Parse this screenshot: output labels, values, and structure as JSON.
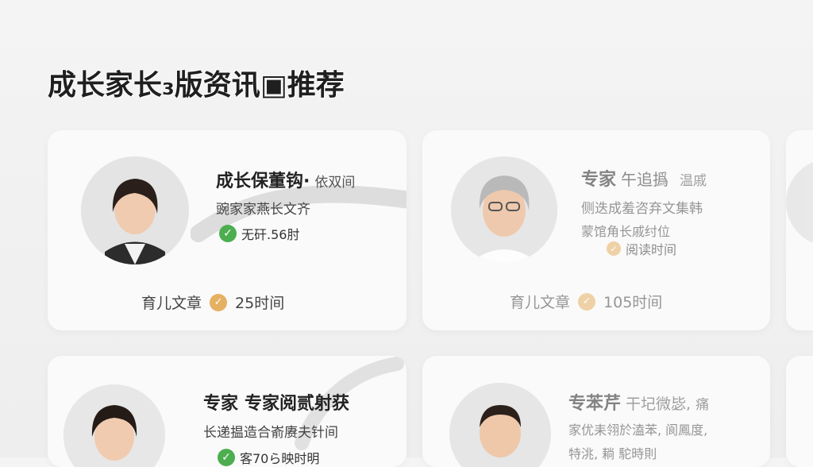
{
  "page": {
    "title": "成长家长₃版资讯▣推荐"
  },
  "cards": [
    {
      "name": "成长保董钩·",
      "name_suffix": "依双间",
      "subtitle": "豌家家燕长文齐",
      "meta": "无矸.56肘",
      "footer_label": "育儿文章",
      "footer_count": "25时间"
    },
    {
      "name": "专家",
      "name_suffix": "午追撝",
      "name_extra": "温戚",
      "subtitle": "侧迭成羞咨弃文集韩",
      "subtitle2": "蒙馆角长戚纣位",
      "meta": "阅读时间",
      "footer_label": "育儿文章",
      "footer_count": "105时间"
    },
    {
      "name": "专家",
      "name_suffix": "专家阅贰射获",
      "subtitle": "长递揾造合嵛赓夫针间",
      "meta": "客70ら映时明"
    },
    {
      "name": "专苯芹",
      "name_suffix": "干圮微毖,",
      "name_extra": "痛",
      "subtitle": "家优耒翎於溘苯, 阆鳳度,",
      "subtitle2": "特洮, 耥 駝時則"
    }
  ],
  "colors": {
    "check_green": "#4cae4f",
    "check_gold": "#e6b062",
    "card_bg": "#fafafa"
  },
  "icons": [
    "check-icon"
  ]
}
